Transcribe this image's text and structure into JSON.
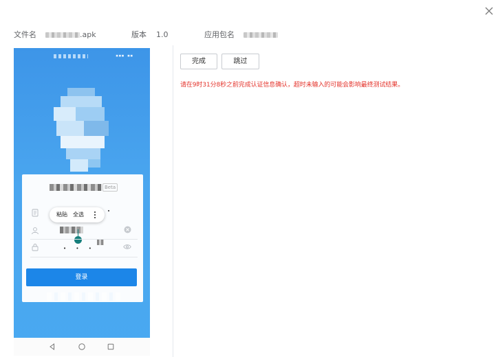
{
  "dialog": {
    "close_icon": "close-icon"
  },
  "info": {
    "file_name_label": "文件名",
    "file_name_suffix": ".apk",
    "version_label": "版本",
    "version_value": "1.0",
    "package_label": "应用包名"
  },
  "phone": {
    "beta_badge": "Beta",
    "context_menu": {
      "paste": "粘贴",
      "select_all": "全选",
      "more_icon": "more-vertical-icon"
    },
    "password_mask": "• • •",
    "login_button": "登录",
    "nav_icons": [
      "back-icon",
      "home-icon",
      "recents-icon"
    ]
  },
  "actions": {
    "done_label": "完成",
    "skip_label": "跳过"
  },
  "notice": "请在9时31分8秒之前完成认证信息确认，超时未输入的可能会影响最终测试结果。",
  "colors": {
    "notice_red": "#e4332b",
    "phone_blue": "#46a3ef",
    "login_button_blue": "#1c86e8",
    "cursor_teal": "#167f7c"
  }
}
